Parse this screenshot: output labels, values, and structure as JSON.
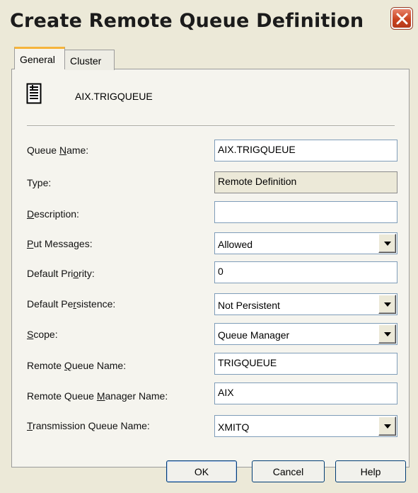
{
  "window": {
    "title": "Create Remote Queue Definition"
  },
  "tabs": [
    {
      "label": "General",
      "selected": true
    },
    {
      "label": "Cluster",
      "selected": false
    }
  ],
  "header": {
    "icon": "document-icon",
    "name": "AIX.TRIGQUEUE"
  },
  "form": {
    "queue_name": {
      "label_pre": "Queue ",
      "label_u": "N",
      "label_post": "ame:",
      "value": "AIX.TRIGQUEUE"
    },
    "type": {
      "label": "Type:",
      "value": "Remote Definition"
    },
    "description": {
      "label_pre": "",
      "label_u": "D",
      "label_post": "escription:",
      "value": ""
    },
    "put_messages": {
      "label_pre": "",
      "label_u": "P",
      "label_post": "ut Messages:",
      "value": "Allowed"
    },
    "default_priority": {
      "label_pre": "Default Pri",
      "label_u": "o",
      "label_post": "rity:",
      "value": "0"
    },
    "default_persistence": {
      "label_pre": "Default Pe",
      "label_u": "r",
      "label_post": "sistence:",
      "value": "Not Persistent"
    },
    "scope": {
      "label_pre": "",
      "label_u": "S",
      "label_post": "cope:",
      "value": "Queue Manager"
    },
    "remote_queue_name": {
      "label_pre": "Remote ",
      "label_u": "Q",
      "label_post": "ueue Name:",
      "value": "TRIGQUEUE"
    },
    "remote_queue_manager_name": {
      "label_pre": "Remote Queue ",
      "label_u": "M",
      "label_post": "anager Name:",
      "value": "AIX"
    },
    "transmission_queue_name": {
      "label_pre": "",
      "label_u": "T",
      "label_post": "ransmission Queue Name:",
      "value": "XMITQ"
    }
  },
  "buttons": {
    "ok": "OK",
    "cancel": "Cancel",
    "help": "Help"
  },
  "colors": {
    "close_button": "#c9421f",
    "tab_highlight": "#f6b43c",
    "field_border": "#7f9db9"
  }
}
